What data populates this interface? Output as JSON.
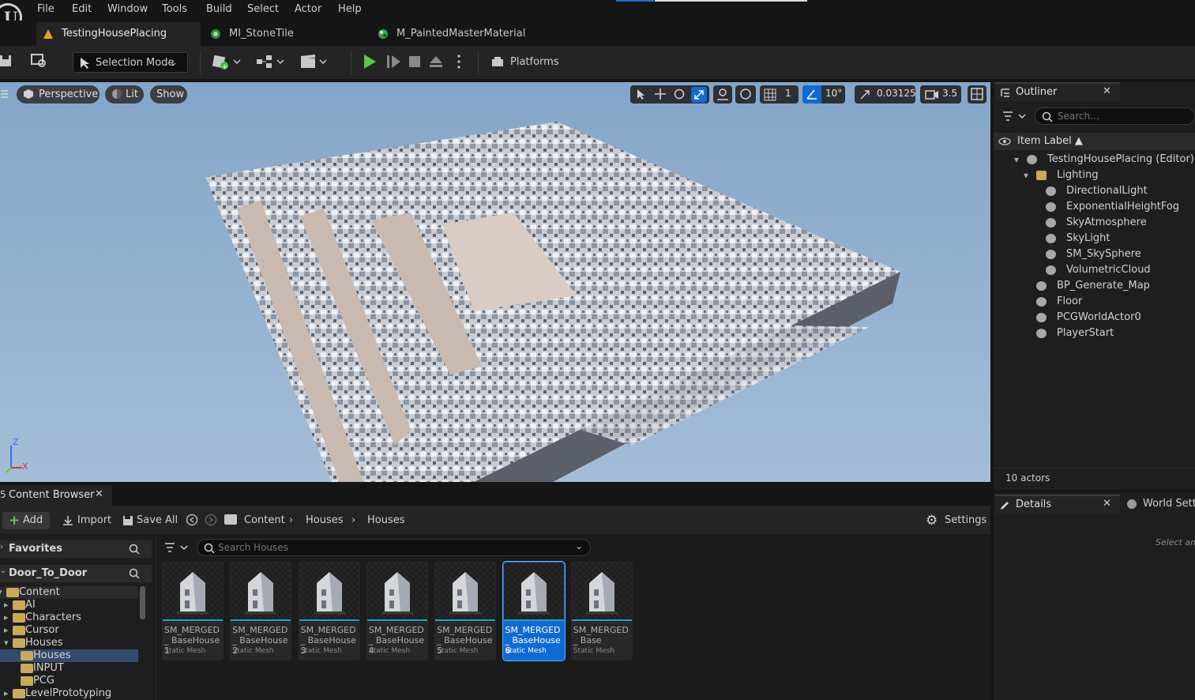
{
  "menu": [
    "File",
    "Edit",
    "Window",
    "Tools",
    "Build",
    "Select",
    "Actor",
    "Help"
  ],
  "tabs": [
    {
      "label": "TestingHousePlacing",
      "icon": "level-icon"
    },
    {
      "label": "MI_StoneTile",
      "icon": "material-instance-icon"
    },
    {
      "label": "M_PaintedMasterMaterial",
      "icon": "material-icon"
    }
  ],
  "toolbar": {
    "selection_mode": "Selection Mode",
    "platforms": "Platforms"
  },
  "viewport": {
    "perspective": "Perspective",
    "lit": "Lit",
    "show": "Show",
    "grid_value": "1",
    "angle_value": "10°",
    "scale_value": "0.03125",
    "camera_speed": "3.5",
    "axis_z": "Z",
    "axis_x": "X"
  },
  "outliner": {
    "title": "Outliner",
    "search_placeholder": "Search...",
    "column": "Item Label ▲",
    "items": [
      {
        "label": "TestingHousePlacing (Editor)",
        "icon": "level-icon"
      },
      {
        "label": "Lighting",
        "icon": "folder-icon"
      },
      {
        "label": "DirectionalLight",
        "icon": "directional-light-icon"
      },
      {
        "label": "ExponentialHeightFog",
        "icon": "fog-icon"
      },
      {
        "label": "SkyAtmosphere",
        "icon": "sky-atmosphere-icon"
      },
      {
        "label": "SkyLight",
        "icon": "sky-light-icon"
      },
      {
        "label": "SM_SkySphere",
        "icon": "static-mesh-icon"
      },
      {
        "label": "VolumetricCloud",
        "icon": "cloud-icon"
      },
      {
        "label": "BP_Generate_Map",
        "icon": "blueprint-icon"
      },
      {
        "label": "Floor",
        "icon": "static-mesh-icon"
      },
      {
        "label": "PCGWorldActor0",
        "icon": "actor-icon"
      },
      {
        "label": "PlayerStart",
        "icon": "player-start-icon"
      }
    ],
    "footer": "10 actors"
  },
  "details": {
    "title": "Details",
    "world_settings": "World Settin",
    "hint": "Select an"
  },
  "content_browser": {
    "title": "Content Browser",
    "add": "Add",
    "import": "Import",
    "save_all": "Save All",
    "breadcrumb": [
      "Content",
      "Houses",
      "Houses"
    ],
    "settings": "Settings",
    "favorites": "Favorites",
    "project": "Door_To_Door",
    "search_placeholder": "Search Houses",
    "tree": [
      {
        "label": "Content",
        "depth": 0,
        "open": true
      },
      {
        "label": "AI",
        "depth": 1,
        "open": false
      },
      {
        "label": "Characters",
        "depth": 1,
        "open": false
      },
      {
        "label": "Cursor",
        "depth": 1,
        "open": false
      },
      {
        "label": "Houses",
        "depth": 1,
        "open": true
      },
      {
        "label": "Houses",
        "depth": 2,
        "open": false
      },
      {
        "label": "INPUT",
        "depth": 2,
        "open": false
      },
      {
        "label": "PCG",
        "depth": 2,
        "open": false
      },
      {
        "label": "LevelPrototyping",
        "depth": 1,
        "open": false
      }
    ],
    "assets": [
      {
        "name": "SM_MERGED_ BaseHouse1",
        "type": "Static Mesh"
      },
      {
        "name": "SM_MERGED_ BaseHouse2",
        "type": "Static Mesh"
      },
      {
        "name": "SM_MERGED_ BaseHouse3",
        "type": "Static Mesh"
      },
      {
        "name": "SM_MERGED_ BaseHouse4",
        "type": "Static Mesh"
      },
      {
        "name": "SM_MERGED_ BaseHouse5",
        "type": "Static Mesh"
      },
      {
        "name": "SM_MERGED_ BaseHouse6",
        "type": "Static Mesh"
      },
      {
        "name": "SM_MERGED_ Base",
        "type": "Static Mesh"
      }
    ]
  },
  "colors": {
    "accent": "#0f6bd1",
    "play": "#5ec64a",
    "folder": "#c9a95a"
  }
}
